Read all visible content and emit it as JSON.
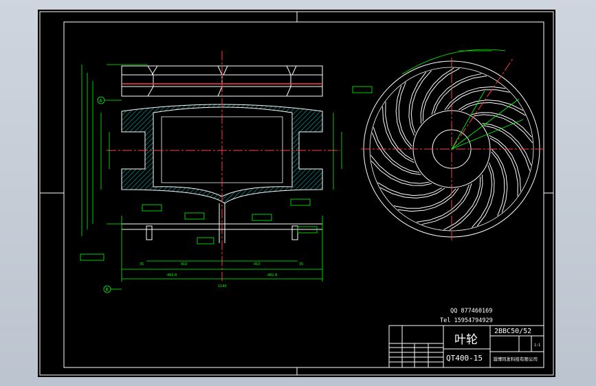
{
  "window": {
    "background_color": "#c9d0da",
    "viewport_color": "#000000"
  },
  "drawing": {
    "colors": {
      "border": "#ffffff",
      "geometry": "#ffffff",
      "dimension": "#00ff00",
      "centerline": "#ff0000",
      "hatch": "#00a0a0",
      "title_block": "#ffffff"
    },
    "contact": {
      "qq": "QQ  877460169",
      "tel": "Tel  15954794929"
    },
    "title_block": {
      "part_name": "叶轮",
      "drawing_number": "2BBC50/52",
      "material": "QT400-15",
      "company": "淄博同发科技有限公司",
      "scale": "1:1"
    },
    "section_view": {
      "overall_width": "1140",
      "left_half": "482.8",
      "right_half": "482.8",
      "left_inner": "410",
      "right_inner": "410",
      "flange_left": "35",
      "flange_right": "35",
      "datum_a": "A",
      "datum_b": "B"
    }
  }
}
